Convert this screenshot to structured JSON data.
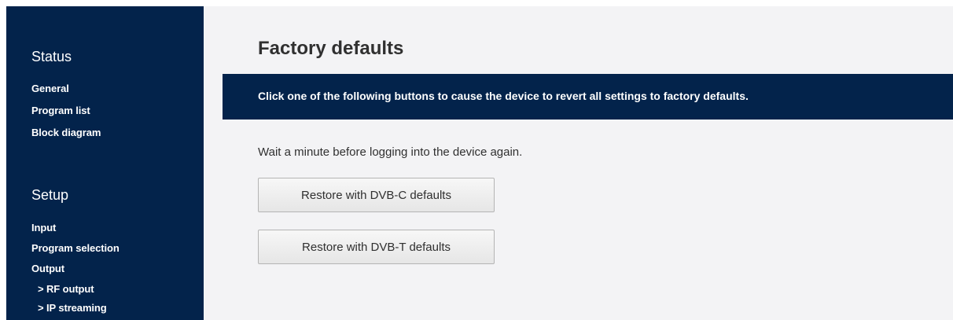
{
  "sidebar": {
    "status_title": "Status",
    "status_items": [
      "General",
      "Program list",
      "Block diagram"
    ],
    "setup_title": "Setup",
    "setup_items": [
      "Input",
      "Program selection",
      "Output"
    ],
    "setup_subitems": [
      "> RF output",
      "> IP streaming"
    ]
  },
  "main": {
    "title": "Factory defaults",
    "banner": "Click one of the following buttons to cause the device to revert all settings to factory defaults.",
    "info": "Wait a minute before logging into the device again.",
    "buttons": {
      "dvbc": "Restore with DVB-C defaults",
      "dvbt": "Restore with DVB-T defaults"
    }
  },
  "colors": {
    "navy": "#03234b",
    "content_bg": "#f3f3f5"
  }
}
